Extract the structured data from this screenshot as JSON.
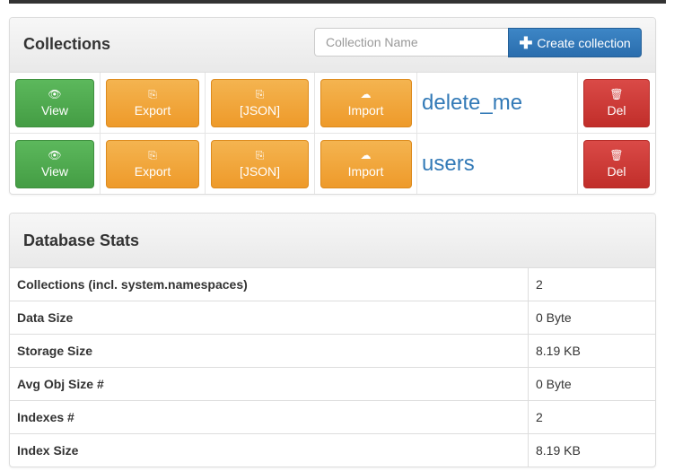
{
  "collections_panel": {
    "title": "Collections",
    "search_placeholder": "Collection Name",
    "create_label": "Create collection",
    "rows": [
      {
        "view": "View",
        "export": "Export",
        "json": "[JSON]",
        "import": "Import",
        "name": "delete_me",
        "del": "Del"
      },
      {
        "view": "View",
        "export": "Export",
        "json": "[JSON]",
        "import": "Import",
        "name": "users",
        "del": "Del"
      }
    ]
  },
  "stats_panel": {
    "title": "Database Stats",
    "rows": [
      {
        "label": "Collections (incl. system.namespaces)",
        "value": "2"
      },
      {
        "label": "Data Size",
        "value": "0 Byte"
      },
      {
        "label": "Storage Size",
        "value": "8.19 KB"
      },
      {
        "label": "Avg Obj Size #",
        "value": "0 Byte"
      },
      {
        "label": "Indexes #",
        "value": "2"
      },
      {
        "label": "Index Size",
        "value": "8.19 KB"
      }
    ]
  },
  "icons": {
    "view": "eye-icon",
    "export": "file-export-icon",
    "json": "file-export-icon",
    "import": "cloud-upload-icon",
    "del": "trash-icon",
    "create": "plus-icon"
  },
  "colors": {
    "primary": "#337ab7",
    "success": "#5cb85c",
    "warning": "#f0ad4e",
    "danger": "#d9534f"
  }
}
